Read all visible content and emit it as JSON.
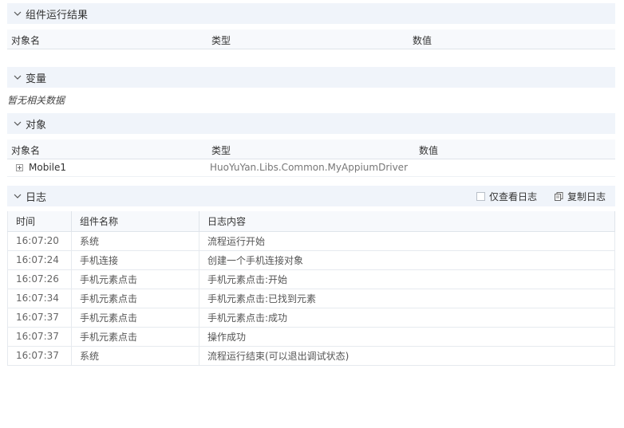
{
  "result_section": {
    "title": "组件运行结果",
    "columns": [
      "对象名",
      "类型",
      "数值"
    ]
  },
  "variables_section": {
    "title": "变量",
    "empty_text": "暂无相关数据"
  },
  "objects_section": {
    "title": "对象",
    "columns": [
      "对象名",
      "类型",
      "数值"
    ],
    "rows": [
      {
        "name": "Mobile1",
        "type": "HuoYuYan.Libs.Common.MyAppiumDriver",
        "value": ""
      }
    ]
  },
  "log_section": {
    "title": "日志",
    "only_view_log_label": "仅查看日志",
    "copy_log_label": "复制日志",
    "columns": [
      "时间",
      "组件名称",
      "日志内容"
    ],
    "rows": [
      {
        "time": "16:07:20",
        "component": "系统",
        "content": "流程运行开始"
      },
      {
        "time": "16:07:24",
        "component": "手机连接",
        "content": "创建一个手机连接对象"
      },
      {
        "time": "16:07:26",
        "component": "手机元素点击",
        "content": "手机元素点击:开始"
      },
      {
        "time": "16:07:34",
        "component": "手机元素点击",
        "content": "手机元素点击:已找到元素"
      },
      {
        "time": "16:07:37",
        "component": "手机元素点击",
        "content": "手机元素点击:成功"
      },
      {
        "time": "16:07:37",
        "component": "手机元素点击",
        "content": "操作成功"
      },
      {
        "time": "16:07:37",
        "component": "系统",
        "content": "流程运行结束(可以退出调试状态)"
      }
    ]
  },
  "colors": {
    "section_bg": "#f0f4fa",
    "header_bg": "#f7f9fc",
    "border": "#dfe4ea"
  },
  "icons": {
    "collapse": "chevron-down-icon",
    "expand": "plus-box-icon",
    "copy": "copy-icon"
  }
}
